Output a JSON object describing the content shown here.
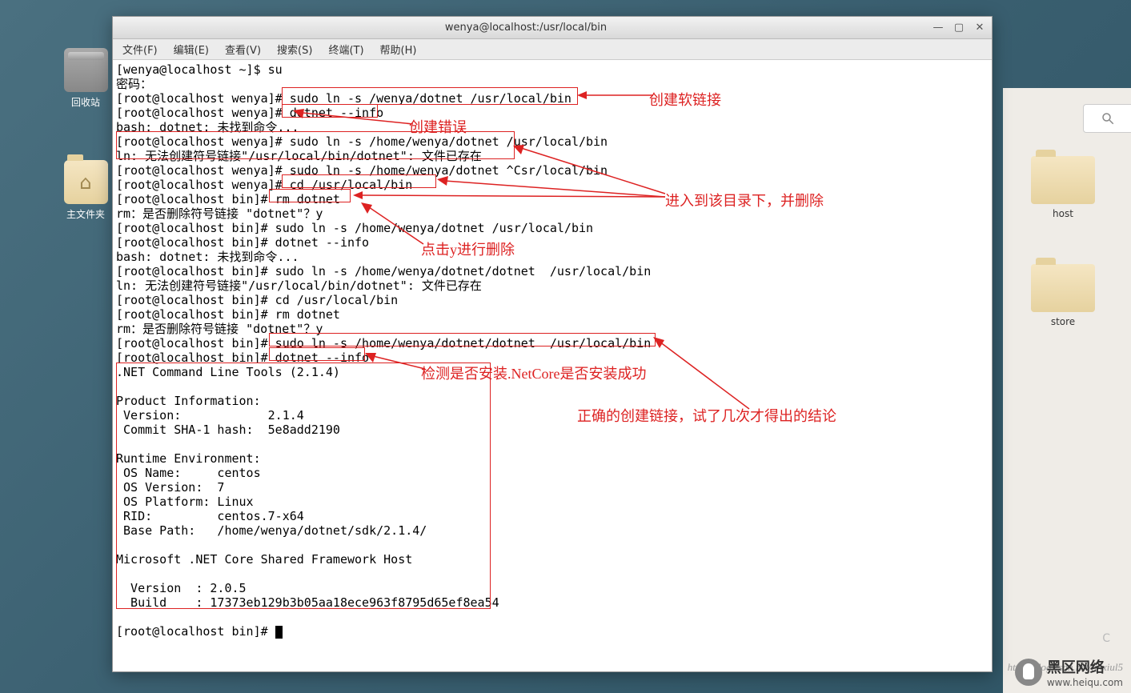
{
  "desktop": {
    "trash_label": "回收站",
    "home_label": "主文件夹",
    "host_label": "host",
    "store_label": "store"
  },
  "window": {
    "title": "wenya@localhost:/usr/local/bin",
    "menu": {
      "file": "文件(F)",
      "edit": "编辑(E)",
      "view": "查看(V)",
      "search": "搜索(S)",
      "terminal": "终端(T)",
      "help": "帮助(H)"
    }
  },
  "terminal": {
    "lines": [
      "[wenya@localhost ~]$ su",
      "密码：",
      "[root@localhost wenya]# sudo ln -s /wenya/dotnet /usr/local/bin",
      "[root@localhost wenya]# dotnet --info",
      "bash: dotnet: 未找到命令...",
      "[root@localhost wenya]# sudo ln -s /home/wenya/dotnet /usr/local/bin",
      "ln: 无法创建符号链接\"/usr/local/bin/dotnet\": 文件已存在",
      "[root@localhost wenya]# sudo ln -s /home/wenya/dotnet ^Csr/local/bin",
      "[root@localhost wenya]# cd /usr/local/bin",
      "[root@localhost bin]# rm dotnet",
      "rm：是否删除符号链接 \"dotnet\"？y",
      "[root@localhost bin]# sudo ln -s /home/wenya/dotnet /usr/local/bin",
      "[root@localhost bin]# dotnet --info",
      "bash: dotnet: 未找到命令...",
      "[root@localhost bin]# sudo ln -s /home/wenya/dotnet/dotnet  /usr/local/bin",
      "ln: 无法创建符号链接\"/usr/local/bin/dotnet\": 文件已存在",
      "[root@localhost bin]# cd /usr/local/bin",
      "[root@localhost bin]# rm dotnet",
      "rm：是否删除符号链接 \"dotnet\"？y",
      "[root@localhost bin]# sudo ln -s /home/wenya/dotnet/dotnet  /usr/local/bin ",
      "[root@localhost bin]# dotnet --info",
      ".NET Command Line Tools (2.1.4)",
      "",
      "Product Information:",
      " Version:            2.1.4",
      " Commit SHA-1 hash:  5e8add2190",
      "",
      "Runtime Environment:",
      " OS Name:     centos",
      " OS Version:  7",
      " OS Platform: Linux",
      " RID:         centos.7-x64",
      " Base Path:   /home/wenya/dotnet/sdk/2.1.4/",
      "",
      "Microsoft .NET Core Shared Framework Host",
      "",
      "  Version  : 2.0.5",
      "  Build    : 17373eb129b3b05aa18ece963f8795d65ef8ea54",
      "",
      "[root@localhost bin]# "
    ]
  },
  "annotations": {
    "a1": "创建软链接",
    "a2": "创建错误",
    "a3": "进入到该目录下，并删除",
    "a4": "点击y进行删除",
    "a5": "检测是否安装.NetCore是否安装成功",
    "a6": "正确的创建链接，试了几次才得出的结论"
  },
  "watermark": {
    "blog": "http://blog.csdn.net/jinxiul5",
    "brand": "黑区网络",
    "url": "www.heiqu.com",
    "indicator": "C"
  }
}
